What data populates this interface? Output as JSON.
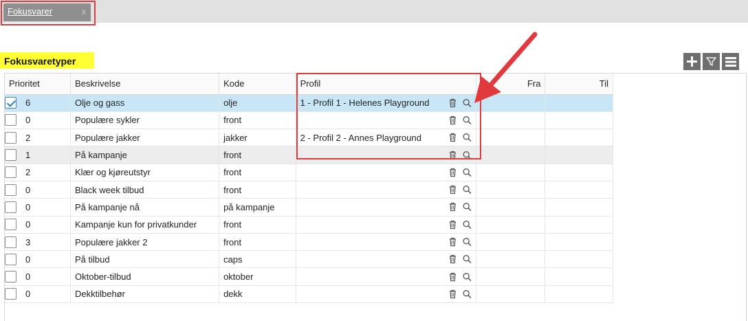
{
  "tab": {
    "label": "Fokusvarer",
    "close": "x"
  },
  "section": {
    "title": "Fokusvaretyper"
  },
  "toolbar": {
    "add_icon": "plus-icon",
    "filter_icon": "filter-icon",
    "menu_icon": "menu-icon"
  },
  "table": {
    "headers": [
      "Prioritet",
      "Beskrivelse",
      "Kode",
      "Profil",
      "Fra",
      "Til"
    ],
    "rows": [
      {
        "checked": true,
        "prioritet": "6",
        "beskrivelse": "Olje og gass",
        "kode": "olje",
        "profil": "1 - Profil 1 - Helenes Playground"
      },
      {
        "checked": false,
        "prioritet": "0",
        "beskrivelse": "Populære sykler",
        "kode": "front",
        "profil": ""
      },
      {
        "checked": false,
        "prioritet": "2",
        "beskrivelse": "Populære jakker",
        "kode": "jakker",
        "profil": "2 - Profil 2 - Annes Playground"
      },
      {
        "checked": false,
        "prioritet": "1",
        "beskrivelse": "På kampanje",
        "kode": "front",
        "profil": ""
      },
      {
        "checked": false,
        "prioritet": "2",
        "beskrivelse": "Klær og kjøreutstyr",
        "kode": "front",
        "profil": ""
      },
      {
        "checked": false,
        "prioritet": "0",
        "beskrivelse": "Black week tilbud",
        "kode": "front",
        "profil": ""
      },
      {
        "checked": false,
        "prioritet": "0",
        "beskrivelse": "På kampanje nå",
        "kode": "på kampanje",
        "profil": ""
      },
      {
        "checked": false,
        "prioritet": "0",
        "beskrivelse": "Kampanje kun for privatkunder",
        "kode": "front",
        "profil": ""
      },
      {
        "checked": false,
        "prioritet": "3",
        "beskrivelse": "Populære jakker 2",
        "kode": "front",
        "profil": ""
      },
      {
        "checked": false,
        "prioritet": "0",
        "beskrivelse": "På tilbud",
        "kode": "caps",
        "profil": ""
      },
      {
        "checked": false,
        "prioritet": "0",
        "beskrivelse": "Oktober-tilbud",
        "kode": "oktober",
        "profil": ""
      },
      {
        "checked": false,
        "prioritet": "0",
        "beskrivelse": "Dekktilbehør",
        "kode": "dekk",
        "profil": ""
      }
    ]
  },
  "colors": {
    "highlight": "#e0393e",
    "selected_row": "#c9e6f7",
    "section_bg": "#ffff33",
    "tab_bg": "#8f8f8f"
  }
}
